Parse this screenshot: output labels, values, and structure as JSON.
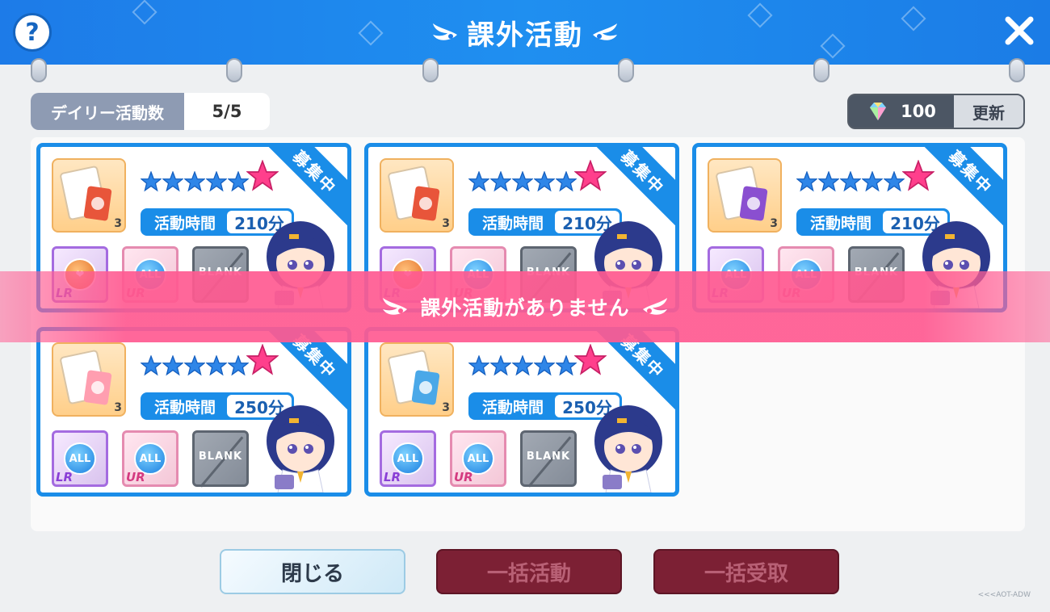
{
  "header": {
    "title": "課外活動",
    "help_icon": "question-mark-icon",
    "close_icon": "close-x-icon"
  },
  "daily": {
    "label": "デイリー活動数",
    "value": "5/5"
  },
  "refresh": {
    "cost": "100",
    "cost_icon": "rainbow-gem-icon",
    "button_label": "更新"
  },
  "cards": [
    {
      "badge": "募集中",
      "time_label": "活動時間",
      "time_value": "210分",
      "icon_level": "3",
      "icon": "skill-book-icon",
      "slots": [
        "LR",
        "UR",
        "BLANK"
      ],
      "slot1_label": "",
      "slot2_label": "ALL",
      "slot3_label": "BLANK"
    },
    {
      "badge": "募集中",
      "time_label": "活動時間",
      "time_value": "210分",
      "icon_level": "3",
      "icon": "skill-book-icon",
      "slots": [
        "LR",
        "UR",
        "BLANK"
      ],
      "slot1_label": "",
      "slot2_label": "ALL",
      "slot3_label": "BLANK"
    },
    {
      "badge": "募集中",
      "time_label": "活動時間",
      "time_value": "210分",
      "icon_level": "3",
      "icon": "skill-book-purple-icon",
      "slots": [
        "LR",
        "UR",
        "BLANK"
      ],
      "slot1_label": "ALL",
      "slot2_label": "ALL",
      "slot3_label": "BLANK"
    },
    {
      "badge": "募集中",
      "time_label": "活動時間",
      "time_value": "250分",
      "icon_level": "3",
      "icon": "piggy-bank-icon",
      "slots": [
        "LR",
        "UR",
        "BLANK"
      ],
      "slot1_label": "ALL",
      "slot2_label": "ALL",
      "slot3_label": "BLANK"
    },
    {
      "badge": "募集中",
      "time_label": "活動時間",
      "time_value": "250分",
      "icon_level": "3",
      "icon": "tickets-icon",
      "slots": [
        "LR",
        "UR",
        "BLANK"
      ],
      "slot1_label": "ALL",
      "slot2_label": "ALL",
      "slot3_label": "BLANK"
    }
  ],
  "banner": {
    "text": "課外活動がありません"
  },
  "buttons": {
    "close": "閉じる",
    "bulk_activity": "一括活動",
    "bulk_receive": "一括受取"
  },
  "footer": {
    "logo_text": "<<<AOT-ADW"
  },
  "colors": {
    "header_blue": "#1d7be8",
    "card_blue": "#1a8de8",
    "banner_pink": "#ff5a91",
    "disabled_red": "#7c2034"
  }
}
